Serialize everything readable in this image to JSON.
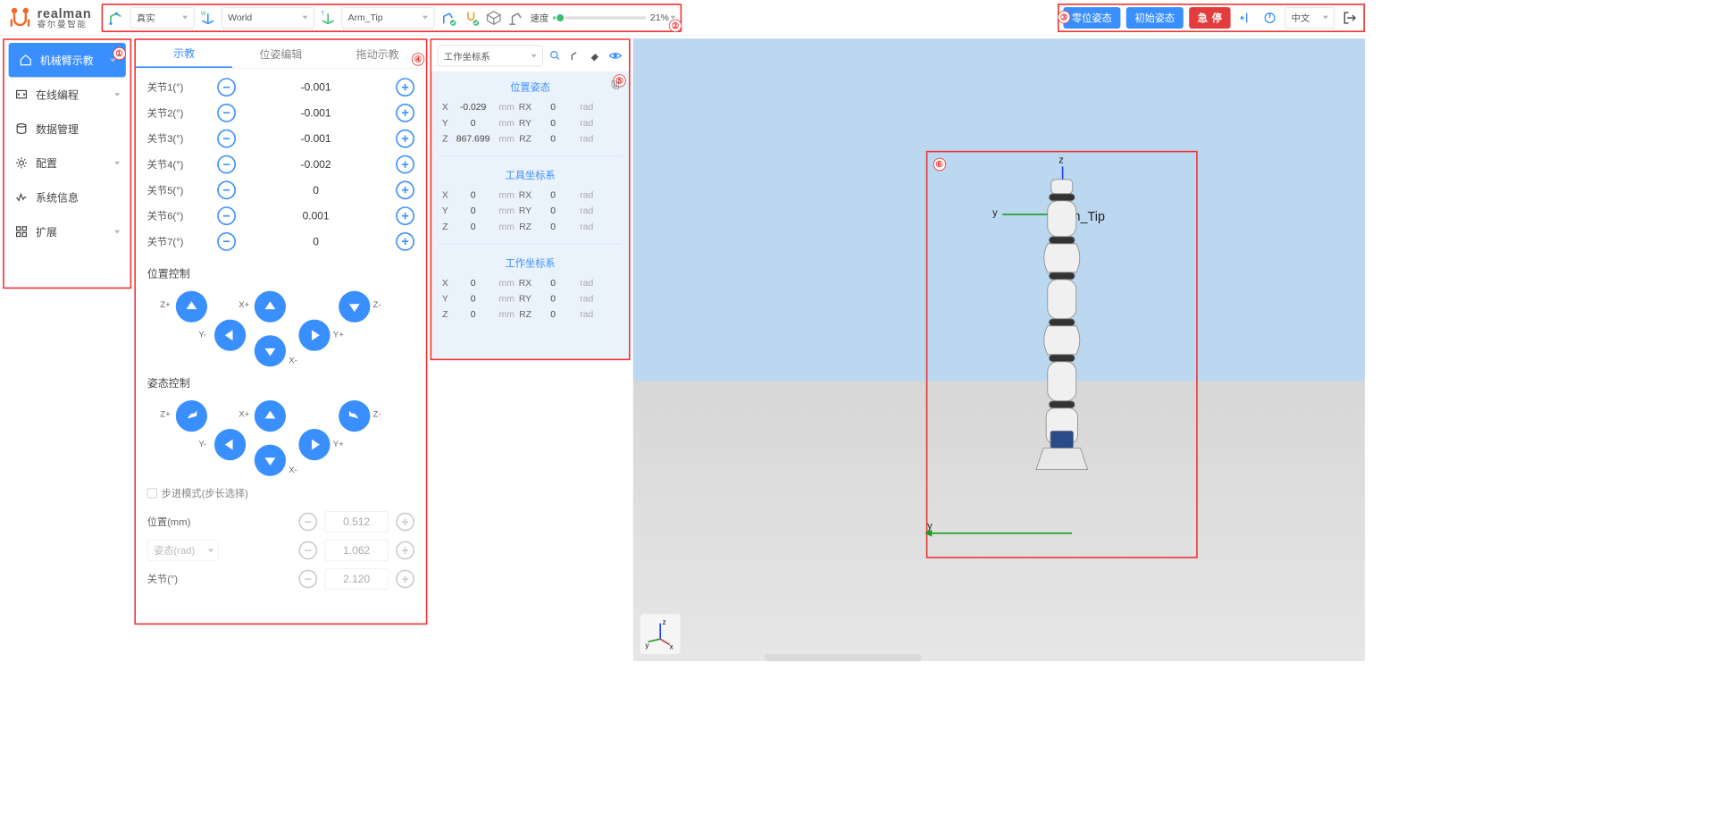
{
  "logo": {
    "main": "realman",
    "sub": "睿尔曼智能"
  },
  "toolbar": {
    "mode": "真实",
    "frame_world": "World",
    "frame_tool": "Arm_Tip",
    "speed_label": "速度",
    "speed_value": "21%"
  },
  "header_right": {
    "zero_pose": "零位姿态",
    "init_pose": "初始姿态",
    "estop": "急停",
    "language": "中文"
  },
  "sidebar": {
    "items": [
      {
        "label": "机械臂示教",
        "expandable": true,
        "active": true
      },
      {
        "label": "在线编程",
        "expandable": true
      },
      {
        "label": "数据管理",
        "expandable": false
      },
      {
        "label": "配置",
        "expandable": true
      },
      {
        "label": "系统信息",
        "expandable": false
      },
      {
        "label": "扩展",
        "expandable": true
      }
    ]
  },
  "teach": {
    "tabs": [
      "示教",
      "位姿编辑",
      "拖动示教"
    ],
    "active_tab": 0,
    "joints": [
      {
        "label": "关节1(°)",
        "value": "-0.001"
      },
      {
        "label": "关节2(°)",
        "value": "-0.001"
      },
      {
        "label": "关节3(°)",
        "value": "-0.001"
      },
      {
        "label": "关节4(°)",
        "value": "-0.002"
      },
      {
        "label": "关节5(°)",
        "value": "0"
      },
      {
        "label": "关节6(°)",
        "value": "0.001"
      },
      {
        "label": "关节7(°)",
        "value": "0"
      }
    ],
    "pos_ctrl_title": "位置控制",
    "pose_ctrl_title": "姿态控制",
    "axes": {
      "zp": "Z+",
      "zm": "Z-",
      "xp": "X+",
      "xm": "X-",
      "yp": "Y+",
      "ym": "Y-"
    },
    "step_label": "步进模式(步长选择)",
    "step_rows": [
      {
        "label": "位置(mm)",
        "value": "0.512",
        "type": "text"
      },
      {
        "label": "姿态(rad)",
        "value": "1.062",
        "type": "select"
      },
      {
        "label": "关节(°)",
        "value": "2.120",
        "type": "text"
      }
    ]
  },
  "coord": {
    "selector": "工作坐标系",
    "sections": [
      {
        "title": "位置姿态",
        "copy": true,
        "rows": [
          {
            "k": "X",
            "v": "-0.029",
            "u": "mm",
            "rk": "RX",
            "rv": "0",
            "ru": "rad"
          },
          {
            "k": "Y",
            "v": "0",
            "u": "mm",
            "rk": "RY",
            "rv": "0",
            "ru": "rad"
          },
          {
            "k": "Z",
            "v": "867.699",
            "u": "mm",
            "rk": "RZ",
            "rv": "0",
            "ru": "rad"
          }
        ]
      },
      {
        "title": "工具坐标系",
        "rows": [
          {
            "k": "X",
            "v": "0",
            "u": "mm",
            "rk": "RX",
            "rv": "0",
            "ru": "rad"
          },
          {
            "k": "Y",
            "v": "0",
            "u": "mm",
            "rk": "RY",
            "rv": "0",
            "ru": "rad"
          },
          {
            "k": "Z",
            "v": "0",
            "u": "mm",
            "rk": "RZ",
            "rv": "0",
            "ru": "rad"
          }
        ]
      },
      {
        "title": "工作坐标系",
        "rows": [
          {
            "k": "X",
            "v": "0",
            "u": "mm",
            "rk": "RX",
            "rv": "0",
            "ru": "rad"
          },
          {
            "k": "Y",
            "v": "0",
            "u": "mm",
            "rk": "RY",
            "rv": "0",
            "ru": "rad"
          },
          {
            "k": "Z",
            "v": "0",
            "u": "mm",
            "rk": "RZ",
            "rv": "0",
            "ru": "rad"
          }
        ]
      }
    ]
  },
  "view": {
    "tip_label": "Arm_Tip"
  },
  "annotations": {
    "1": "①",
    "2": "②",
    "3": "③",
    "4": "④",
    "5": "⑤",
    "6": "⑥"
  }
}
